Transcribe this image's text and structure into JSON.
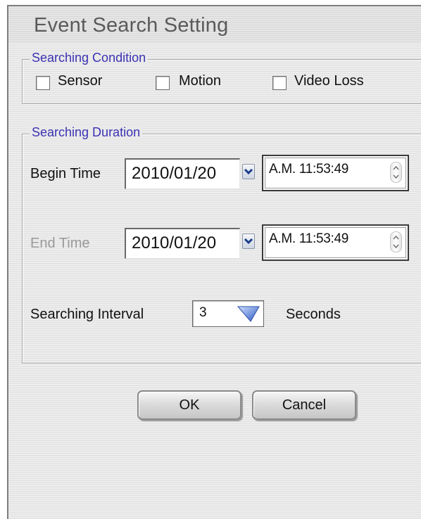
{
  "dialog": {
    "title": "Event Search Setting"
  },
  "searching_condition": {
    "legend": "Searching Condition",
    "options": [
      {
        "label": "Sensor",
        "checked": false
      },
      {
        "label": "Motion",
        "checked": false
      },
      {
        "label": "Video Loss",
        "checked": false
      }
    ]
  },
  "searching_duration": {
    "legend": "Searching Duration",
    "begin_time": {
      "label": "Begin Time",
      "date": "2010/01/20",
      "time": "A.M. 11:53:49"
    },
    "end_time": {
      "label": "End Time",
      "enabled": false,
      "date": "2010/01/20",
      "time": "A.M. 11:53:49"
    },
    "interval": {
      "label": "Searching Interval",
      "value": "3",
      "unit": "Seconds"
    }
  },
  "buttons": {
    "ok": "OK",
    "cancel": "Cancel"
  },
  "colors": {
    "legend_text": "#3b32b2",
    "dropdown_arrow": "#3f67c8"
  },
  "icons": [
    "chevron-down-icon",
    "spinner-icon",
    "triangle-down-icon"
  ]
}
